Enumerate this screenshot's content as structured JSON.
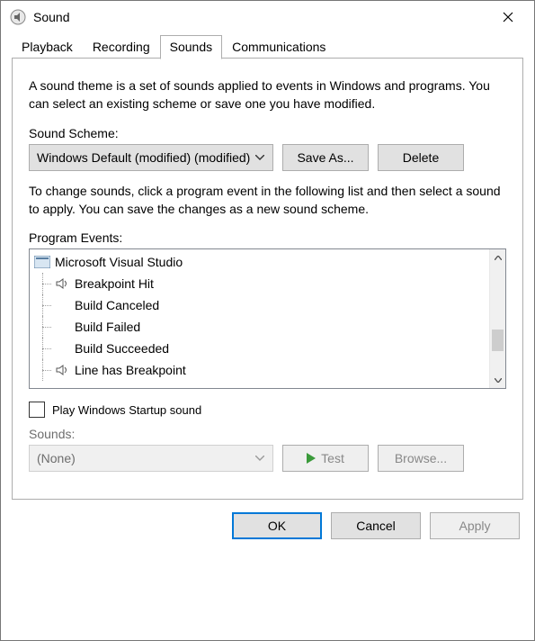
{
  "window": {
    "title": "Sound"
  },
  "tabs": {
    "playback": "Playback",
    "recording": "Recording",
    "sounds": "Sounds",
    "communications": "Communications"
  },
  "panel": {
    "desc1": "A sound theme is a set of sounds applied to events in Windows and programs.  You can select an existing scheme or save one you have modified.",
    "scheme_label": "Sound Scheme:",
    "scheme_value": "Windows Default (modified) (modified)",
    "save_as": "Save As...",
    "delete": "Delete",
    "desc2": "To change sounds, click a program event in the following list and then select a sound to apply.  You can save the changes as a new sound scheme.",
    "events_label": "Program Events:",
    "events": {
      "group": "Microsoft Visual Studio",
      "items": [
        {
          "label": "Breakpoint Hit",
          "has_sound": true
        },
        {
          "label": "Build Canceled",
          "has_sound": false
        },
        {
          "label": "Build Failed",
          "has_sound": false
        },
        {
          "label": "Build Succeeded",
          "has_sound": false
        },
        {
          "label": "Line has Breakpoint",
          "has_sound": true
        }
      ]
    },
    "startup_checkbox": "Play Windows Startup sound",
    "sounds_label": "Sounds:",
    "sounds_value": "(None)",
    "test": "Test",
    "browse": "Browse..."
  },
  "footer": {
    "ok": "OK",
    "cancel": "Cancel",
    "apply": "Apply"
  }
}
